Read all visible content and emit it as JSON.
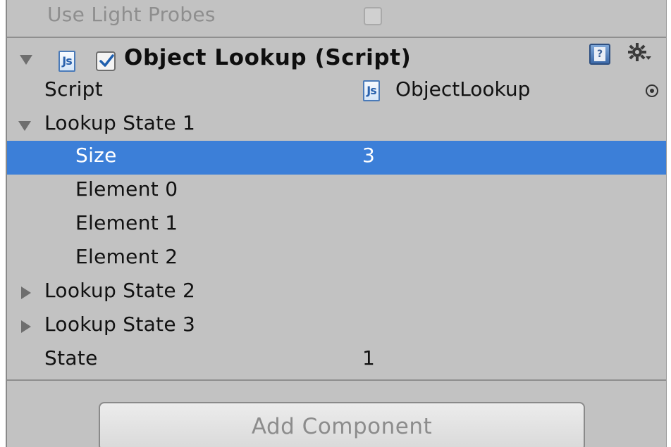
{
  "previous_component": {
    "property_label": "Use Light Probes",
    "checked": false
  },
  "component": {
    "title": "Object Lookup (Script)",
    "enabled": true,
    "icon": "js-script-icon",
    "help_icon": "help-book-icon",
    "settings_icon": "gear-icon"
  },
  "fields": {
    "script": {
      "label": "Script",
      "value": "ObjectLookup",
      "value_icon": "js-script-icon",
      "picker_icon": "object-picker-icon"
    },
    "lookup_state_1": {
      "label": "Lookup State 1",
      "expanded": true,
      "size_label": "Size",
      "size_value": "3",
      "elements": [
        "Element 0",
        "Element 1",
        "Element 2"
      ]
    },
    "lookup_state_2": {
      "label": "Lookup State 2",
      "expanded": false
    },
    "lookup_state_3": {
      "label": "Lookup State 3",
      "expanded": false
    },
    "state": {
      "label": "State",
      "value": "1"
    }
  },
  "footer": {
    "add_component_label": "Add Component"
  },
  "colors": {
    "panel_background": "#c2c2c2",
    "selection": "#3c7fd8",
    "disabled_text": "#8e8e8e"
  }
}
